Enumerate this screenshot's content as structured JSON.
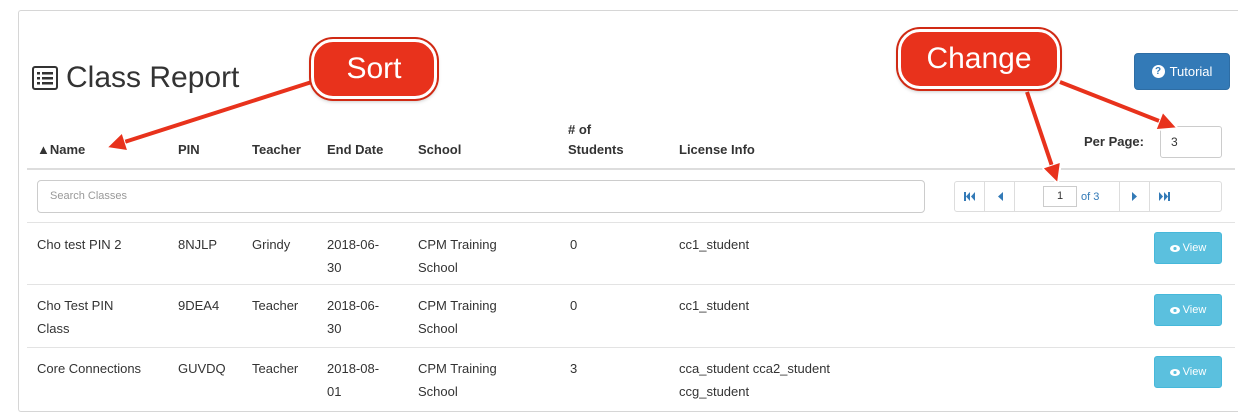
{
  "page": {
    "title": "Class Report",
    "tutorial_label": "Tutorial"
  },
  "table": {
    "headers": {
      "name": "▲Name",
      "pin": "PIN",
      "teacher": "Teacher",
      "end_date": "End Date",
      "school": "School",
      "students_line1": "# of",
      "students_line2": "Students",
      "license": "License Info"
    },
    "rows": [
      {
        "name": [
          "Cho test PIN 2"
        ],
        "pin": "8NJLP",
        "teacher": "Grindy",
        "end_date": [
          "2018-06-",
          "30"
        ],
        "school": [
          "CPM Training",
          "School"
        ],
        "students": "0",
        "license": [
          "cc1_student"
        ],
        "action": "View"
      },
      {
        "name": [
          "Cho Test PIN",
          "Class"
        ],
        "pin": "9DEA4",
        "teacher": "Teacher",
        "end_date": [
          "2018-06-",
          "30"
        ],
        "school": [
          "CPM Training",
          "School"
        ],
        "students": "0",
        "license": [
          "cc1_student"
        ],
        "action": "View"
      },
      {
        "name": [
          "Core Connections"
        ],
        "pin": "GUVDQ",
        "teacher": "Teacher",
        "end_date": [
          "2018-08-",
          "01"
        ],
        "school": [
          "CPM Training",
          "School"
        ],
        "students": "3",
        "license": [
          "cca_student cca2_student",
          "ccg_student"
        ],
        "action": "View"
      }
    ]
  },
  "search": {
    "placeholder": "Search Classes"
  },
  "per_page": {
    "label": "Per Page:",
    "value": "3"
  },
  "pagination": {
    "current": "1",
    "of_label": "of 3"
  },
  "annotations": {
    "sort": "Sort",
    "change": "Change"
  },
  "colors": {
    "primary": "#337ab7",
    "info": "#5bc0de",
    "callout": "#e8321c"
  }
}
